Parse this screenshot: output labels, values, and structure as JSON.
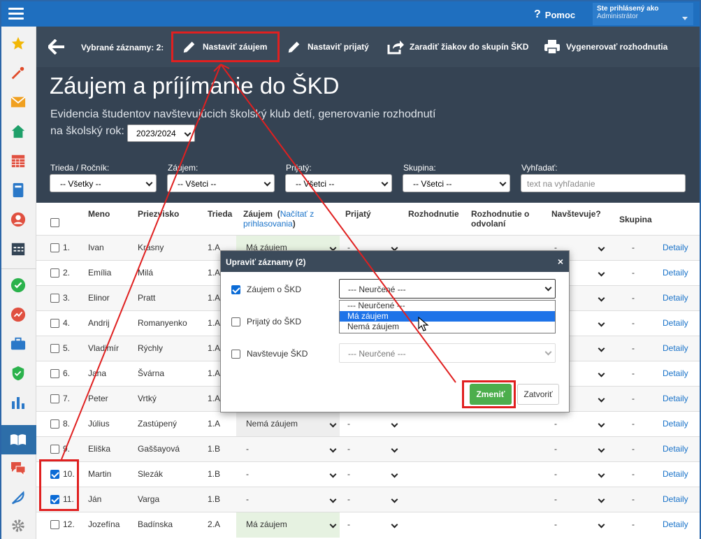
{
  "topbar": {
    "help_label": "Pomoc",
    "user_line1": "Ste prihlásený ako",
    "user_line2": "Administrátor"
  },
  "toolbar": {
    "selected_label": "Vybrané záznamy: 2:",
    "set_interest": "Nastaviť záujem",
    "set_accepted": "Nastaviť prijatý",
    "assign_groups": "Zaradiť žiakov do skupín ŠKD",
    "generate": "Vygenerovať rozhodnutia"
  },
  "page": {
    "title": "Záujem a príjímanie do ŠKD",
    "subtitle": "Evidencia študentov navštevujúcich školský klub detí, generovanie rozhodnutí",
    "year_label": "na školský rok:",
    "year_value": "2023/2024"
  },
  "filters": {
    "class_label": "Trieda / Ročník:",
    "class_value": "-- Všetky --",
    "interest_label": "Záujem:",
    "interest_value": "-- Všetci --",
    "accepted_label": "Prijatý:",
    "accepted_value": "-- Všetci --",
    "group_label": "Skupina:",
    "group_value": "-- Všetci --",
    "search_label": "Vyhľadať:",
    "search_placeholder": "text na vyhľadanie"
  },
  "table": {
    "headers": {
      "name": "Meno",
      "surname": "Priezvisko",
      "class": "Trieda",
      "interest": "Záujem",
      "interest_link": "Načítať z prihlasovania",
      "accepted": "Prijatý",
      "decision": "Rozhodnutie",
      "appeal": "Rozhodnutie o odvolaní",
      "attends": "Navštevuje?",
      "group": "Skupina"
    },
    "rows": [
      {
        "no": "1.",
        "name": "Ivan",
        "surname": "Krásny",
        "class": "1.A",
        "interest": "Má záujem",
        "accepted": "-",
        "attends": "-",
        "group": "-",
        "detail": "Detaily",
        "checked": false
      },
      {
        "no": "2.",
        "name": "Emília",
        "surname": "Milá",
        "class": "1.A",
        "interest": "",
        "accepted": "-",
        "attends": "-",
        "group": "-",
        "detail": "Detaily",
        "checked": false
      },
      {
        "no": "3.",
        "name": "Elinor",
        "surname": "Pratt",
        "class": "1.A",
        "interest": "",
        "accepted": "-",
        "attends": "-",
        "group": "-",
        "detail": "Detaily",
        "checked": false
      },
      {
        "no": "4.",
        "name": "Andrij",
        "surname": "Romanyenko",
        "class": "1.A",
        "interest": "",
        "accepted": "-",
        "attends": "-",
        "group": "-",
        "detail": "Detaily",
        "checked": false
      },
      {
        "no": "5.",
        "name": "Vladimír",
        "surname": "Rýchly",
        "class": "1.A",
        "interest": "",
        "accepted": "-",
        "attends": "-",
        "group": "-",
        "detail": "Detaily",
        "checked": false
      },
      {
        "no": "6.",
        "name": "Jana",
        "surname": "Švárna",
        "class": "1.A",
        "interest": "",
        "accepted": "-",
        "attends": "-",
        "group": "-",
        "detail": "Detaily",
        "checked": false
      },
      {
        "no": "7.",
        "name": "Peter",
        "surname": "Vrtký",
        "class": "1.A",
        "interest": "",
        "accepted": "-",
        "attends": "-",
        "group": "-",
        "detail": "Detaily",
        "checked": false
      },
      {
        "no": "8.",
        "name": "Július",
        "surname": "Zastúpený",
        "class": "1.A",
        "interest": "Nemá záujem",
        "accepted": "-",
        "attends": "-",
        "group": "-",
        "detail": "Detaily",
        "checked": false
      },
      {
        "no": "9.",
        "name": "Eliška",
        "surname": "Gaššayová",
        "class": "1.B",
        "interest": "-",
        "accepted": "-",
        "attends": "-",
        "group": "-",
        "detail": "Detaily",
        "checked": false
      },
      {
        "no": "10.",
        "name": "Martin",
        "surname": "Slezák",
        "class": "1.B",
        "interest": "-",
        "accepted": "-",
        "attends": "-",
        "group": "-",
        "detail": "Detaily",
        "checked": true
      },
      {
        "no": "11.",
        "name": "Ján",
        "surname": "Varga",
        "class": "1.B",
        "interest": "-",
        "accepted": "-",
        "attends": "-",
        "group": "-",
        "detail": "Detaily",
        "checked": true
      },
      {
        "no": "12.",
        "name": "Jozefína",
        "surname": "Badínska",
        "class": "2.A",
        "interest": "Má záujem",
        "accepted": "-",
        "attends": "-",
        "group": "-",
        "detail": "Detaily",
        "checked": false
      }
    ]
  },
  "modal": {
    "title": "Upraviť záznamy (2)",
    "close": "×",
    "interest_label": "Záujem o ŠKD",
    "interest_value": "--- Neurčené ---",
    "options": [
      "--- Neurčené ---",
      "Má záujem",
      "Nemá záujem"
    ],
    "highlighted": "Má záujem",
    "accepted_label": "Prijatý do ŠKD",
    "attends_label": "Navštevuje ŠKD",
    "attends_value": "--- Neurčené ---",
    "change_button": "Zmeniť",
    "close_button": "Zatvoriť"
  },
  "colors": {
    "topbar": "#1f6fbf",
    "header": "#354353",
    "toolbar": "#3b4a5a",
    "highlight": "#e02020",
    "green": "#4cae4c",
    "interest_bg": "#e6f2e1"
  },
  "icons": [
    "menu-icon",
    "question-icon",
    "back-arrow-icon",
    "pencil-icon",
    "share-icon",
    "printer-icon",
    "star-icon",
    "wand-icon",
    "envelope-icon",
    "home-icon",
    "calendar-icon",
    "book-icon",
    "user-icon",
    "schedule-icon",
    "check-circle-icon",
    "chart-icon",
    "briefcase-icon",
    "shield-icon",
    "bar-chart-icon",
    "open-book-icon",
    "chat-icon",
    "feather-icon",
    "gear-icon",
    "close-icon",
    "cursor-icon"
  ]
}
